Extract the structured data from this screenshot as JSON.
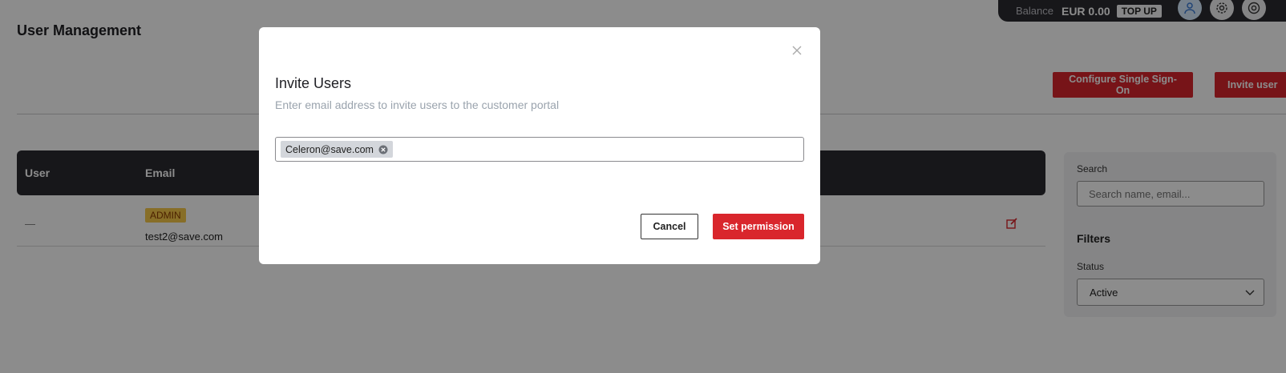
{
  "topbar": {
    "balance_label": "Balance",
    "balance_value": "EUR 0.00",
    "topup_label": "TOP UP",
    "icons": [
      "user-icon",
      "gear-icon",
      "help-icon"
    ]
  },
  "page": {
    "title": "User Management",
    "configure_sso_label": "Configure Single Sign-On",
    "invite_user_label": "Invite user"
  },
  "table": {
    "columns": [
      "User",
      "Email"
    ],
    "rows": [
      {
        "user": "—",
        "badge": "ADMIN",
        "email": "test2@save.com"
      }
    ]
  },
  "sidepanel": {
    "search_label": "Search",
    "search_placeholder": "Search name, email...",
    "filters_title": "Filters",
    "status_label": "Status",
    "status_value": "Active"
  },
  "modal": {
    "title": "Invite Users",
    "subtitle": "Enter email address to invite users to the customer portal",
    "chips": [
      "Celeron@save.com"
    ],
    "cancel_label": "Cancel",
    "set_permission_label": "Set permission"
  },
  "colors": {
    "accent_red": "#d9262c",
    "dark": "#2a2a30",
    "overlay": "rgba(0,0,0,0.45)"
  }
}
